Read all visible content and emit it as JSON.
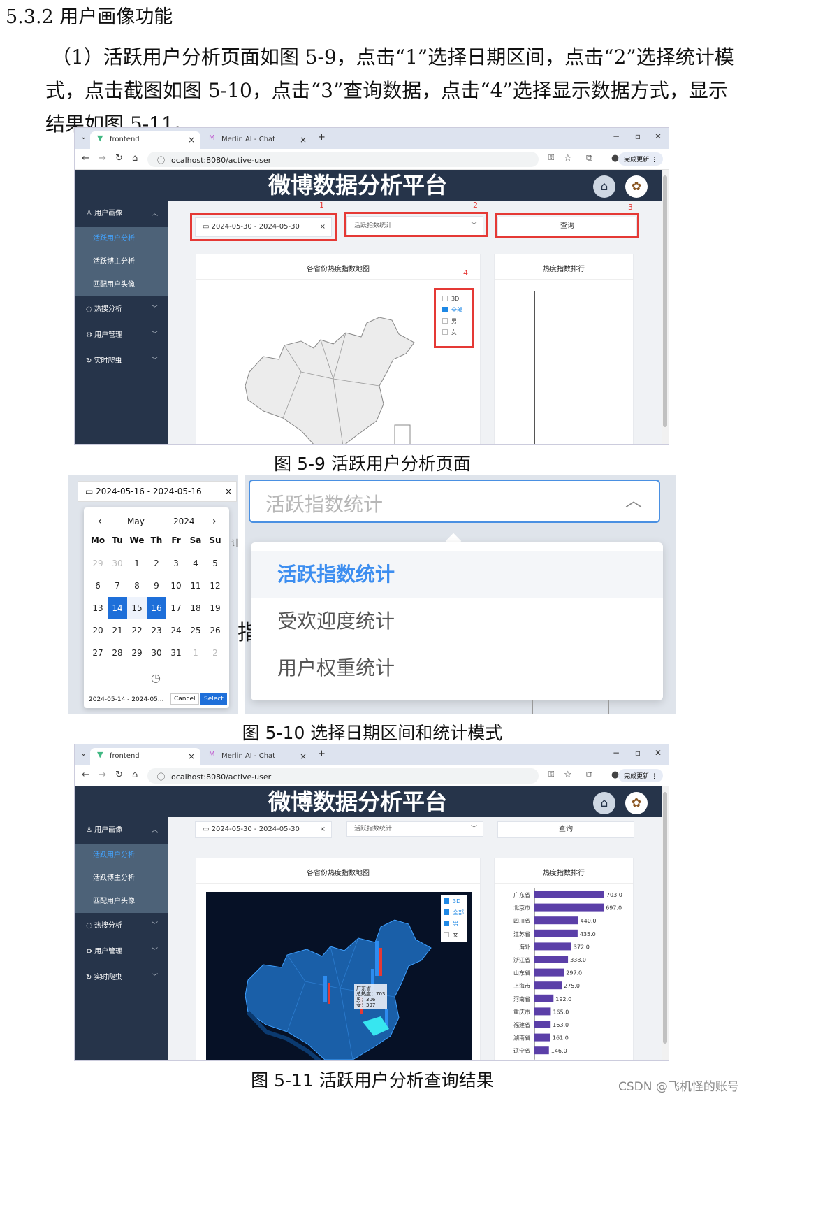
{
  "section_heading": "5.3.2 用户画像功能",
  "paragraph": [
    "（1）活跃用户分析页面如图 5-9，点击“1”选择日期区间，点击“2”选择统计模",
    "式，点击截图如图 5-10，点击“3”查询数据，点击“4”选择显示数据方式，显示",
    "结果如图 5-11。"
  ],
  "captions": {
    "fig9": "图 5-9 活跃用户分析页面",
    "fig10": "图 5-10 选择日期区间和统计模式",
    "fig11": "图 5-11 活跃用户分析查询结果"
  },
  "watermark": "CSDN @飞机怪的账号",
  "browser": {
    "tab1": "frontend",
    "tab2": "Merlin AI - Chat",
    "url": "localhost:8080/active-user",
    "update_btn": "完成更新",
    "new_tab": "+",
    "win_min": "−",
    "win_max": "▫",
    "win_close": "✕"
  },
  "app": {
    "title": "微博数据分析平台",
    "menu": [
      {
        "label": "用户画像"
      },
      {
        "label": "热搜分析"
      },
      {
        "label": "用户管理"
      },
      {
        "label": "实时爬虫"
      }
    ],
    "submenu": [
      "活跃用户分析",
      "活跃博主分析",
      "匹配用户头像"
    ],
    "date_range": "2024-05-30 - 2024-05-30",
    "mode": "活跃指数统计",
    "query_btn": "查询",
    "map_title": "各省份热度指数地图",
    "rank_title": "热度指数排行",
    "legend": [
      "3D",
      "全部",
      "男",
      "女"
    ],
    "legend_fig9_checked": [
      false,
      true,
      false,
      false
    ],
    "legend_fig11_checked": [
      true,
      true,
      true,
      false
    ],
    "markers": [
      "1",
      "2",
      "3",
      "4"
    ],
    "tooltip": [
      "广东省",
      "总热度：703",
      "男：306",
      "女：397"
    ]
  },
  "chart_data": {
    "type": "bar",
    "title": "热度指数排行",
    "categories": [
      "广东省",
      "北京市",
      "四川省",
      "江苏省",
      "海外",
      "浙江省",
      "山东省",
      "上海市",
      "河南省",
      "重庆市",
      "福建省",
      "湖南省",
      "辽宁省"
    ],
    "values": [
      703.0,
      697.0,
      440.0,
      435.0,
      372.0,
      338.0,
      297.0,
      275.0,
      192.0,
      165.0,
      163.0,
      161.0,
      146.0
    ],
    "xlim": [
      0,
      900
    ]
  },
  "fig10": {
    "date_range": "2024-05-16 - 2024-05-16",
    "month": "May",
    "year": "2024",
    "weekdays": [
      "Mo",
      "Tu",
      "We",
      "Th",
      "Fr",
      "Sa",
      "Su"
    ],
    "days": [
      [
        "29",
        "30",
        "1",
        "2",
        "3",
        "4",
        "5"
      ],
      [
        "6",
        "7",
        "8",
        "9",
        "10",
        "11",
        "12"
      ],
      [
        "13",
        "14",
        "15",
        "16",
        "17",
        "18",
        "19"
      ],
      [
        "20",
        "21",
        "22",
        "23",
        "24",
        "25",
        "26"
      ],
      [
        "27",
        "28",
        "29",
        "30",
        "31",
        "1",
        "2"
      ]
    ],
    "footer_range": "2024-05-14 - 2024-05...",
    "cancel": "Cancel",
    "select": "Select",
    "dropdown_value": "活跃指数统计",
    "options": [
      "活跃指数统计",
      "受欢迎度统计",
      "用户权重统计"
    ],
    "behind_text": "指",
    "behind_text2": "计"
  }
}
